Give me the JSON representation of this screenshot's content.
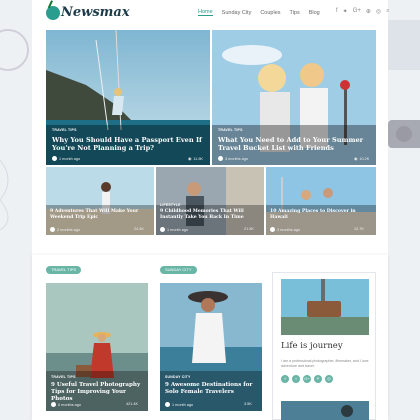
{
  "brand": {
    "logo_text": "Newsmax"
  },
  "nav": {
    "items": [
      "Home",
      "Sunday City",
      "Couples",
      "Tips",
      "Blog"
    ]
  },
  "social": {
    "icons": [
      "facebook-icon",
      "twitter-icon",
      "google-plus-icon",
      "pinterest-icon",
      "instagram-icon",
      "search-icon"
    ],
    "glyphs": [
      "f",
      "✦",
      "G+",
      "⊕",
      "◎",
      "⌕"
    ]
  },
  "featured": [
    {
      "tag": "Travel Tips",
      "title": "Why You Should Have a Passport Even If You're Not Planning a Trip?",
      "date": "1 month ago",
      "views": "11.6K"
    },
    {
      "tag": "Travel Tips",
      "title": "What You Need to Add to Your Summer Travel Bucket List with Friends",
      "date": "3 months ago",
      "views": "10.2K"
    }
  ],
  "small_cards": [
    {
      "tag": "",
      "title": "9 Adventures That Will Make Your Weekend Trip Epic",
      "date": "2 months ago",
      "views": "24.4K"
    },
    {
      "tag": "Lifestyle",
      "title": "9 Childhood Memories That Will Instantly Take You Back In Time",
      "date": "1 month ago",
      "views": "21.5K"
    },
    {
      "tag": "",
      "title": "10 Amazing Places to Discover in Hawaii",
      "date": "3 months ago",
      "views": "12.7K"
    }
  ],
  "sections": [
    {
      "label": "Travel Tips"
    },
    {
      "label": "Sunday City"
    }
  ],
  "bottom_cards": [
    {
      "tag": "Travel Tips",
      "title": "9 Useful Travel Photography Tips for Improving Your Photos",
      "date": "6 months ago",
      "views": "421.4K"
    },
    {
      "tag": "Sunday City",
      "title": "9 Awesome Destinations for Solo Female Travelers",
      "date": "1 month ago",
      "views": "3.5K"
    }
  ],
  "sidebar": {
    "title": "Life is journey",
    "text": "I am a professional photographer, filmmaker, and I love adventure and travel.",
    "icons": [
      "f",
      "t",
      "G+",
      "P",
      "◎"
    ]
  }
}
